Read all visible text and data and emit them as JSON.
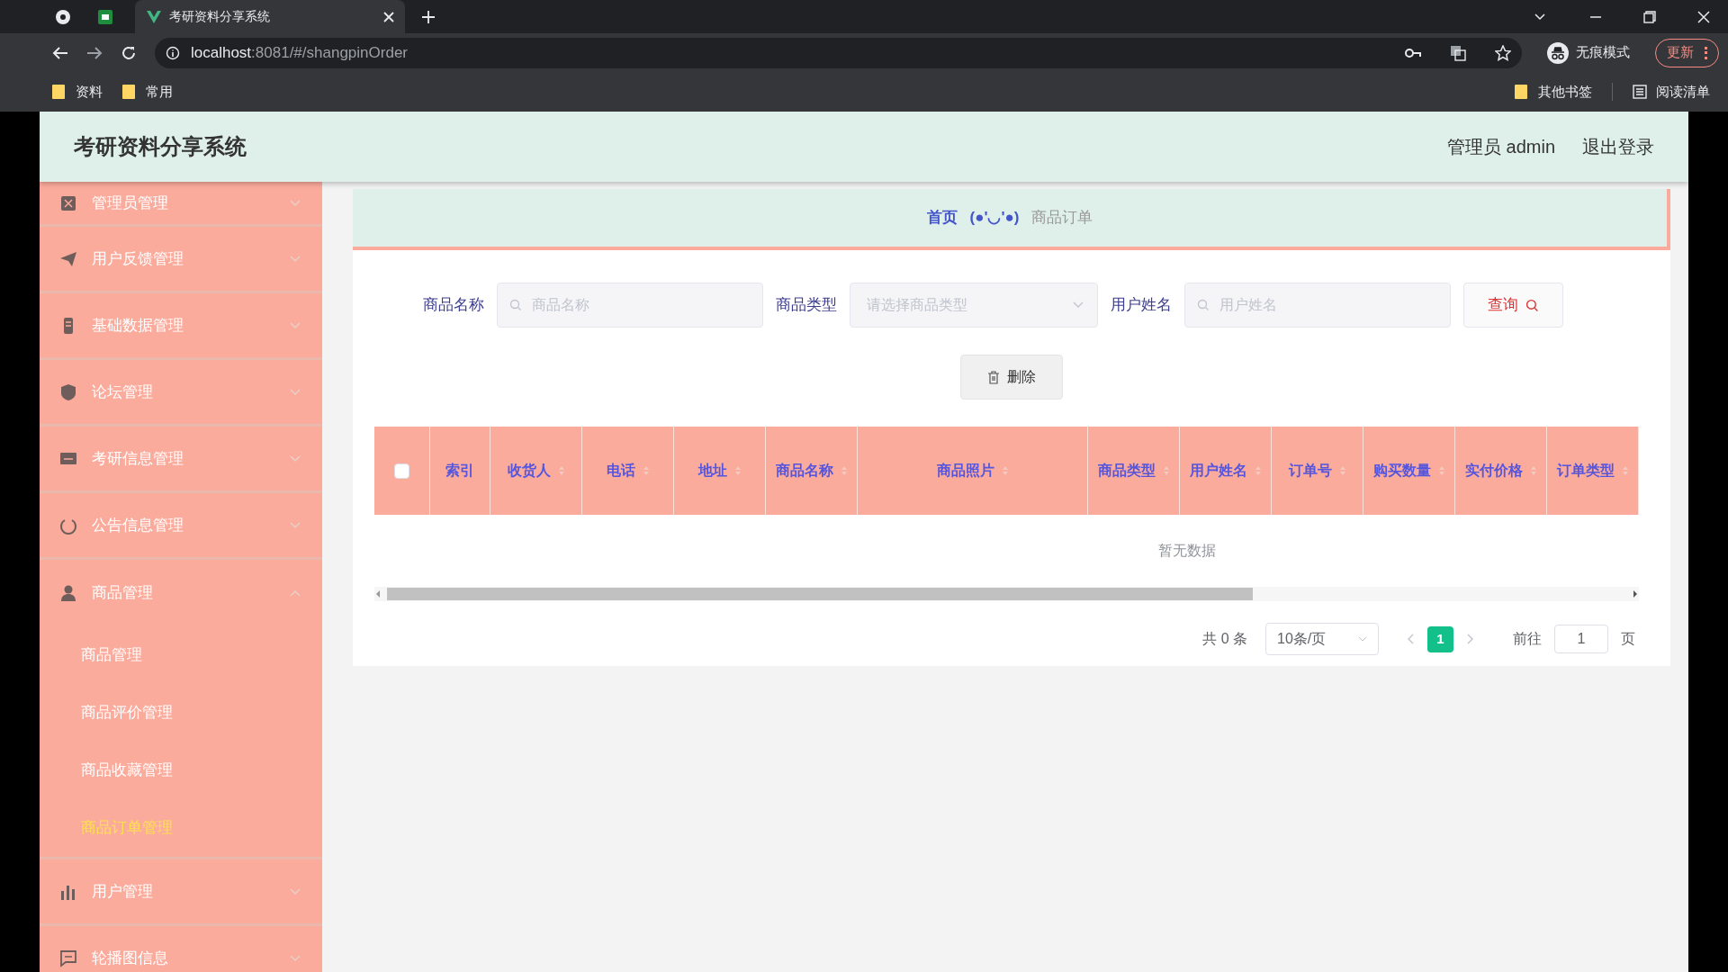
{
  "browser": {
    "tab_title": "考研资料分享系统",
    "url_host": "localhost",
    "url_rest": ":8081/#/shangpinOrder",
    "incognito_label": "无痕模式",
    "update_button": "更新",
    "bookmarks": [
      "资料",
      "常用"
    ],
    "bookmarks_right": [
      "其他书签",
      "阅读清单"
    ]
  },
  "header": {
    "title": "考研资料分享系统",
    "user": "管理员 admin",
    "logout": "退出登录"
  },
  "sidebar": {
    "items": [
      {
        "label": "管理员管理",
        "expanded": false
      },
      {
        "label": "用户反馈管理",
        "expanded": false
      },
      {
        "label": "基础数据管理",
        "expanded": false
      },
      {
        "label": "论坛管理",
        "expanded": false
      },
      {
        "label": "考研信息管理",
        "expanded": false
      },
      {
        "label": "公告信息管理",
        "expanded": false
      },
      {
        "label": "商品管理",
        "expanded": true,
        "children": [
          {
            "label": "商品管理",
            "selected": false
          },
          {
            "label": "商品评价管理",
            "selected": false
          },
          {
            "label": "商品收藏管理",
            "selected": false
          },
          {
            "label": "商品订单管理",
            "selected": true
          }
        ]
      },
      {
        "label": "用户管理",
        "expanded": false
      },
      {
        "label": "轮播图信息",
        "expanded": false
      }
    ]
  },
  "breadcrumb": {
    "home": "首页",
    "face": "(●'◡'●)",
    "current": "商品订单"
  },
  "filters": [
    {
      "kind": "text",
      "label": "商品名称",
      "placeholder": "商品名称"
    },
    {
      "kind": "select",
      "label": "商品类型",
      "placeholder": "请选择商品类型"
    },
    {
      "kind": "text",
      "label": "用户姓名",
      "placeholder": "用户姓名"
    }
  ],
  "search_button": "查询",
  "delete_button": "删除",
  "table": {
    "select_all_checked": false,
    "columns": [
      "索引",
      "收货人",
      "电话",
      "地址",
      "商品名称",
      "商品照片",
      "商品类型",
      "用户姓名",
      "订单号",
      "购买数量",
      "实付价格",
      "订单类型"
    ],
    "empty_text": "暂无数据"
  },
  "pagination": {
    "total": "共 0 条",
    "page_size": "10条/页",
    "pages": [
      {
        "label": "1",
        "selected": true
      }
    ],
    "goto_label": "前往",
    "goto_value": "1",
    "goto_suffix": "页"
  }
}
